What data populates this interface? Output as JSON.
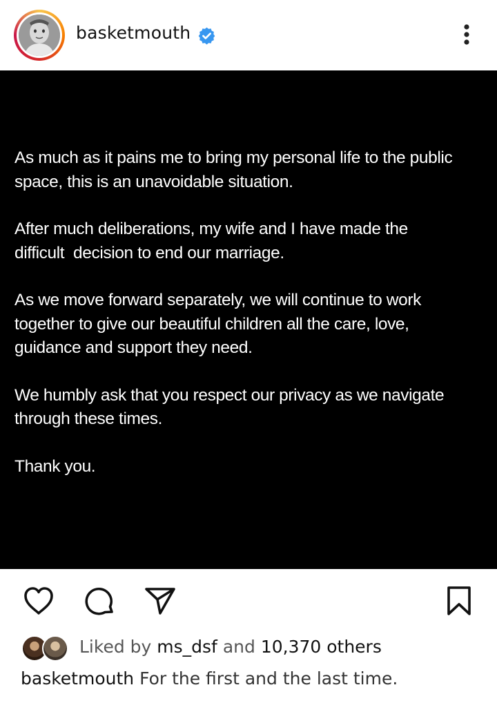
{
  "header": {
    "username": "basketmouth",
    "verified_icon": "verified-badge-icon",
    "more_icon": "more-vertical-icon"
  },
  "post": {
    "paragraphs": [
      "As much as it pains me to bring my personal life to the public\nspace, this is an unavoidable situation.",
      "After much deliberations, my wife and I have made the\ndifficult  decision to end our marriage.",
      "As we move forward separately, we will continue to work\ntogether to give our beautiful children all the care, love,\nguidance and support they need.",
      "We humbly ask that you respect our privacy as we navigate\nthrough these times.",
      "Thank you."
    ]
  },
  "actions": {
    "like_icon": "heart-icon",
    "comment_icon": "comment-icon",
    "share_icon": "send-icon",
    "save_icon": "bookmark-icon"
  },
  "likes": {
    "prefix": "Liked by",
    "user": "ms_dsf",
    "connector": "and",
    "count_text": "10,370 others"
  },
  "caption": {
    "username": "basketmouth",
    "text": "For the first and the last time."
  },
  "colors": {
    "verified": "#3897f0",
    "post_background": "#000000",
    "text": "#111111"
  }
}
